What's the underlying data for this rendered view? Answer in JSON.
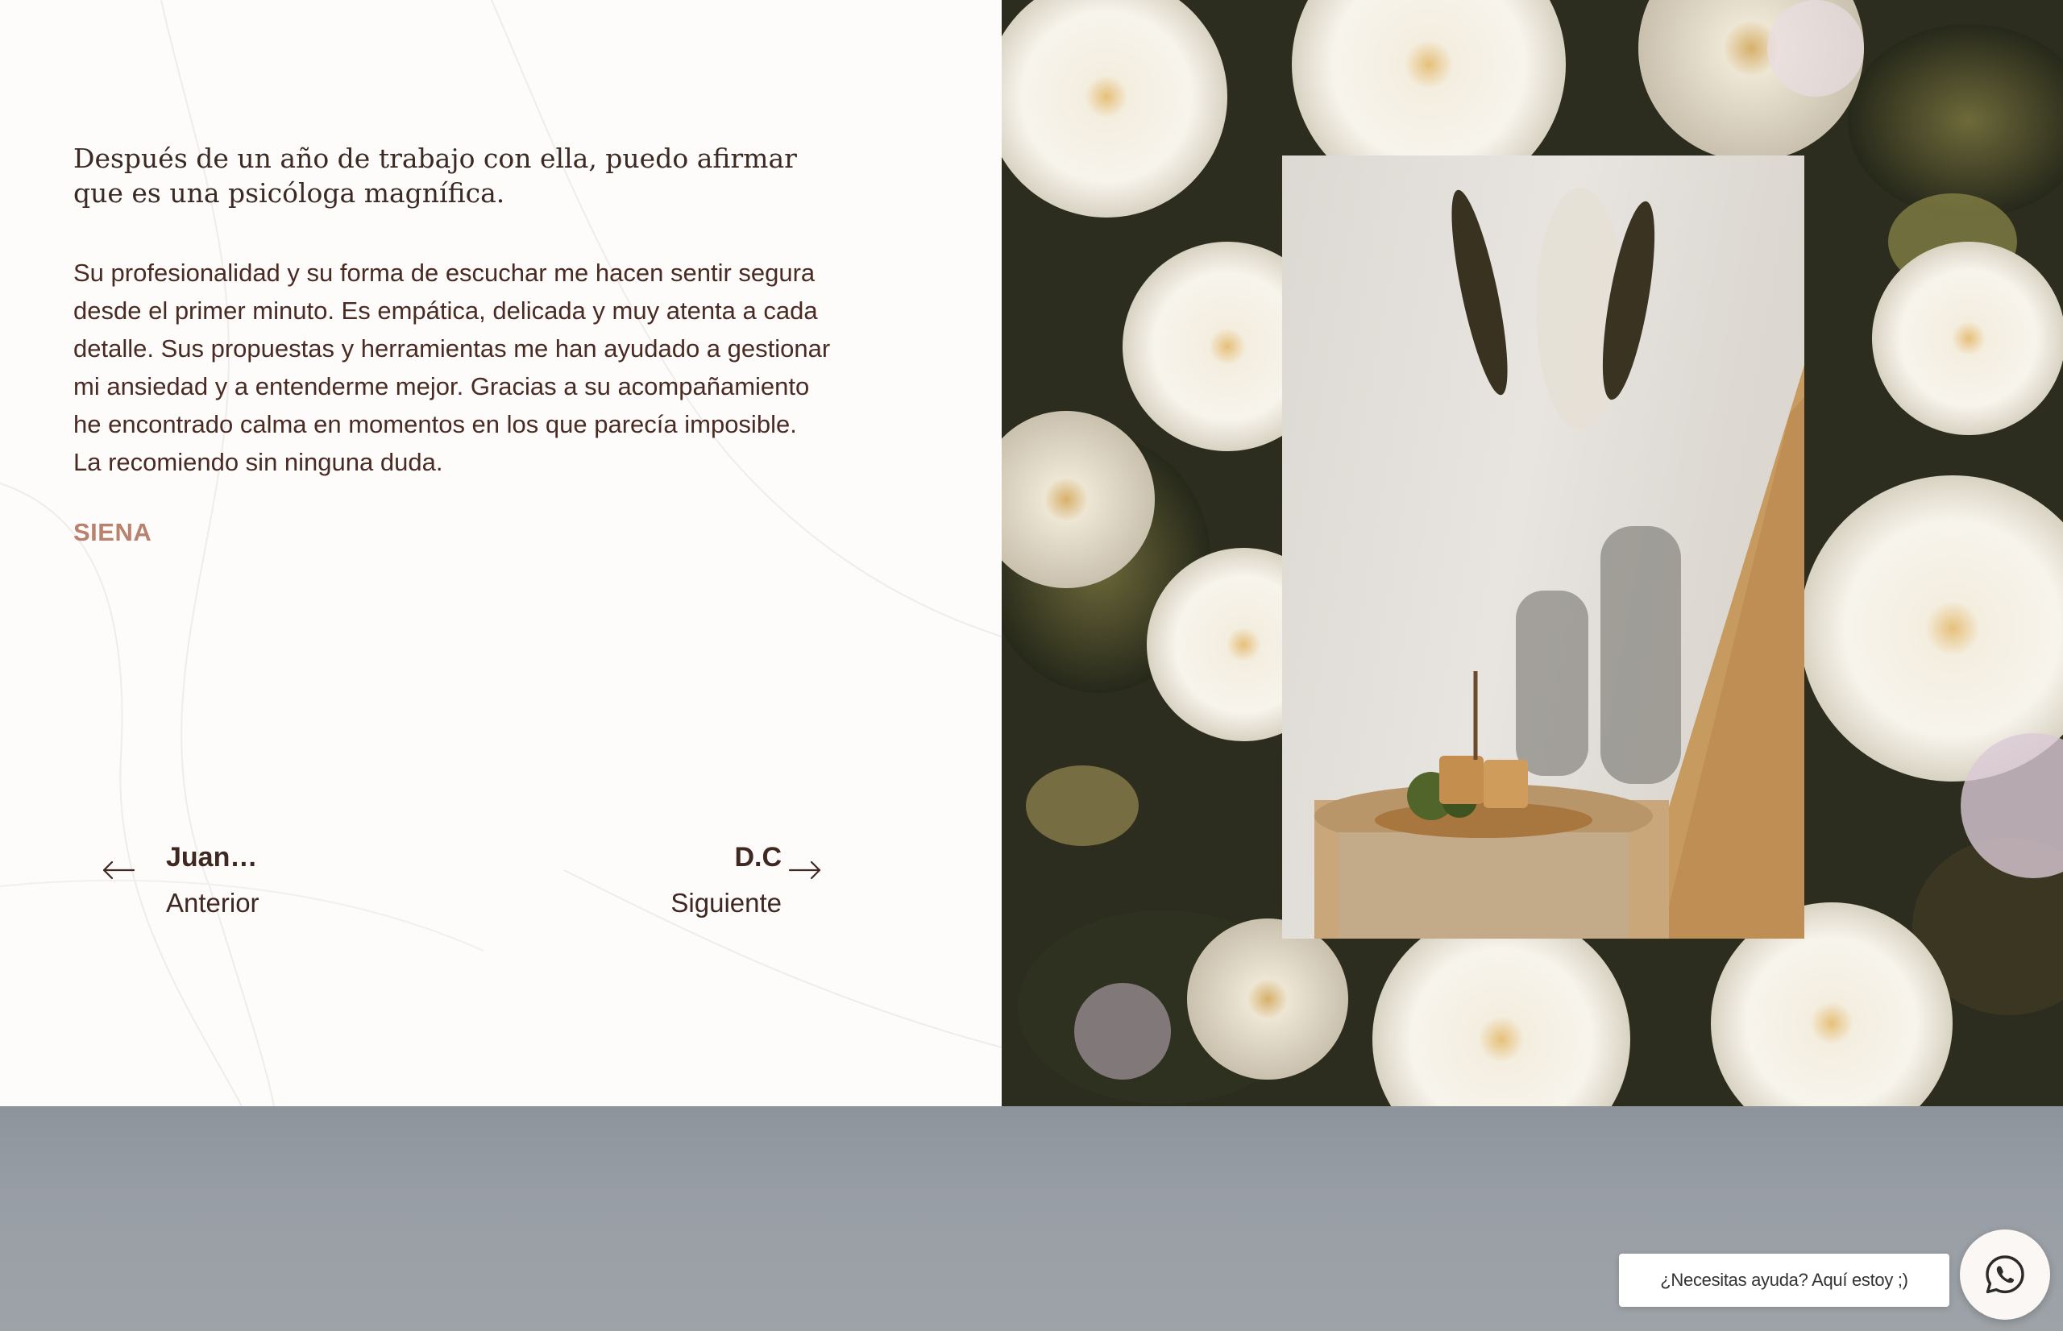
{
  "testimonial": {
    "lead": "Después de un año de trabajo con ella, puedo afirmar que es una psicóloga magnífica.",
    "body": "Su profesionalidad y su forma de escuchar me hacen sentir segura desde el primer minuto. Es empática, delicada y muy atenta a cada detalle. Sus propuestas y herramientas me han ayudado a gestionar mi ansiedad y a entenderme mejor. Gracias a su acompañamiento he encontrado calma en momentos en los que parecía imposible. La recomiendo sin ninguna duda.",
    "author": "SIENA"
  },
  "navigation": {
    "previous": {
      "title": "Juan…",
      "label": "Anterior",
      "icon": "arrow-left-icon"
    },
    "next": {
      "title": "D.C",
      "label": "Siguiente",
      "icon": "arrow-right-icon"
    }
  },
  "chat_widget": {
    "message": "¿Necesitas ayuda? Aquí estoy ;)",
    "icon": "whatsapp-icon"
  },
  "colors": {
    "text_dark": "#3f2722",
    "author_accent": "#b9826e",
    "page_background": "#fdfcfb",
    "bottom_band": "#989ea5"
  }
}
